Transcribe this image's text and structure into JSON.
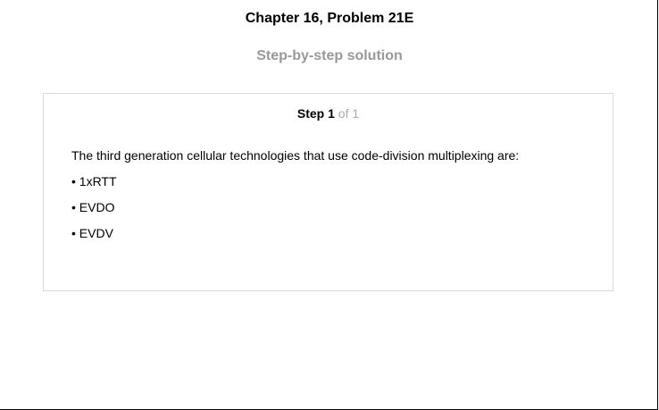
{
  "header": {
    "title": "Chapter 16, Problem 21E",
    "subtitle": "Step-by-step solution"
  },
  "step": {
    "label": "Step",
    "number": "1",
    "of_text": "of 1"
  },
  "solution": {
    "intro": "The third generation cellular technologies that use code-division multiplexing are:",
    "bullets": [
      "• 1xRTT",
      "• EVDO",
      "• EVDV"
    ]
  }
}
